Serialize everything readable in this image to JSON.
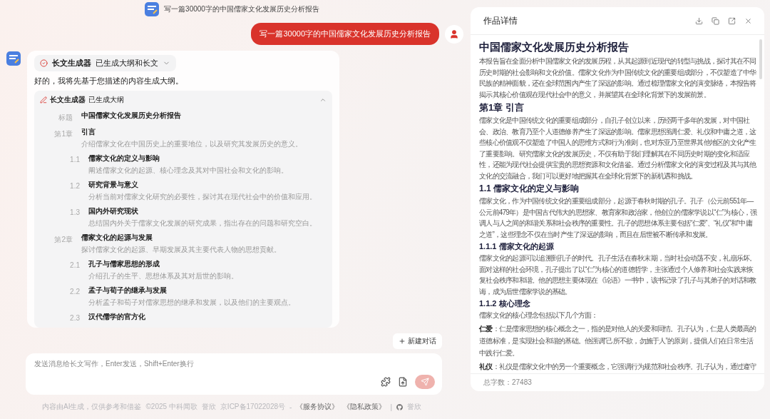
{
  "chat": {
    "title": "写一篇30000字的中国儒家文化发展历史分析报告",
    "user_message": "写一篇30000字的中国儒家文化发展历史分析报告",
    "tool_chip": {
      "name": "长文生成器",
      "status": "已生成大纲和长文",
      "expanded": false
    },
    "reply": "好的，我将先基于您描述的内容生成大纲。",
    "outline": {
      "name": "长文生成器",
      "status": "已生成大纲",
      "expanded": true,
      "items": [
        {
          "label": "标题",
          "title": "中国儒家文化发展历史分析报告"
        },
        {
          "label": "第1章",
          "title": "引言",
          "desc": "介绍儒家文化在中国历史上的重要地位，以及研究其发展历史的意义。",
          "children": [
            {
              "label": "1.1",
              "title": "儒家文化的定义与影响",
              "desc": "阐述儒家文化的起源、核心理念及其对中国社会和文化的影响。"
            },
            {
              "label": "1.2",
              "title": "研究背景与意义",
              "desc": "分析当前对儒家文化研究的必要性，探讨其在现代社会中的价值和应用。"
            },
            {
              "label": "1.3",
              "title": "国内外研究现状",
              "desc": "总结国内外关于儒家文化发展的研究成果，指出存在的问题和研究空白。"
            }
          ]
        },
        {
          "label": "第2章",
          "title": "儒家文化的起源与发展",
          "desc": "探讨儒家文化的起源、早期发展及其主要代表人物的思想贡献。",
          "children": [
            {
              "label": "2.1",
              "title": "孔子与儒家思想的形成",
              "desc": "介绍孔子的生平、思想体系及其对后世的影响。"
            },
            {
              "label": "2.2",
              "title": "孟子与荀子的继承与发展",
              "desc": "分析孟子和荀子对儒家思想的继承和发展，以及他们的主要观点。"
            },
            {
              "label": "2.3",
              "title": "汉代儒学的官方化"
            }
          ]
        }
      ]
    },
    "new_chat": "新建对话",
    "input": {
      "placeholder": "发送消息给长文写作，Enter发送，Shift+Enter换行"
    },
    "footer": {
      "texts": [
        "内容由AI生成，仅供参考和借鉴",
        "©2025 中科闻歌",
        "誉欣",
        "京ICP备17022028号",
        "-"
      ],
      "links": [
        "《服务协议》",
        "《隐私政策》"
      ],
      "separator": "|",
      "github_text": "誉欣"
    }
  },
  "detail": {
    "title": "作品详情",
    "blocks": [
      {
        "kind": "h1",
        "text": "中国儒家文化发展历史分析报告"
      },
      {
        "kind": "p",
        "text": "本报告旨在全面分析中国儒家文化的发展历程，从其起源到近现代的转型与挑战，探讨其在不同历史时期的社会影响和文化价值。儒家文化作为中国传统文化的重要组成部分，不仅塑造了中华民族的精神面貌，还在全球范围内产生了深远的影响。通过梳理儒家文化的演变脉络，本报告将揭示其核心价值观在现代社会中的意义，并展望其在全球化背景下的发展前景。"
      },
      {
        "kind": "h2",
        "text": "第1章 引言"
      },
      {
        "kind": "p",
        "text": "儒家文化是中国传统文化的重要组成部分，自孔子创立以来，历经两千多年的发展，对中国社会、政治、教育乃至个人道德修养产生了深远的影响。儒家思想强调仁爱、礼仪和中庸之道，这些核心价值观不仅塑造了中国人的思维方式和行为准则，也对东亚乃至世界其他地区的文化产生了重要影响。研究儒家文化的发展历史，不仅有助于我们理解其在不同历史时期的变化和适应性，还能为现代社会提供宝贵的思想资源和文化借鉴。通过分析儒家文化的演变过程及其与其他文化的交流融合，我们可以更好地把握其在全球化背景下的新机遇和挑战。"
      },
      {
        "kind": "h3",
        "text": "1.1 儒家文化的定义与影响"
      },
      {
        "kind": "p",
        "text": "儒家文化，作为中国传统文化的重要组成部分，起源于春秋时期的孔子。孔子（公元前551年—公元前479年）是中国古代伟大的思想家、教育家和政治家，他创立的儒家学说以“仁”为核心，强调人与人之间的和谐关系和社会秩序的重要性。孔子的思想体系主要包括“仁爱”、“礼仪”和“中庸之道”，这些理念不仅在当时产生了深远的影响，而且在后世被不断传承和发展。"
      },
      {
        "kind": "h4",
        "text": "1.1.1 儒家文化的起源"
      },
      {
        "kind": "p",
        "text": "儒家文化的起源可以追溯到孔子的时代。孔子生活在春秋末期，当时社会动荡不安，礼崩乐坏。面对这样的社会环境，孔子提出了以“仁”为核心的道德哲学，主张通过个人修养和社会实践来恢复社会秩序和和谐。他的思想主要体现在《论语》一书中，该书记录了孔子与其弟子的对话和教诲，成为后世儒家学说的基础。"
      },
      {
        "kind": "h4",
        "text": "1.1.2 核心理念"
      },
      {
        "kind": "p",
        "text": "儒家文化的核心理念包括以下几个方面："
      },
      {
        "kind": "li",
        "text": "**仁爱**：仁是儒家思想的核心概念之一，指的是对他人的关爱和同情。孔子认为，仁是人类最高的道德标准，是实现社会和谐的基础。他强调“己所不欲，勿施于人”的原则，提倡人们在日常生活中践行仁爱。"
      },
      {
        "kind": "li",
        "text": "**礼仪**：礼仪是儒家文化中的另一个重要概念，它强调行为规范和社会秩序。孔子认为，通过遵守"
      }
    ],
    "word_count": "总字数：27483"
  }
}
